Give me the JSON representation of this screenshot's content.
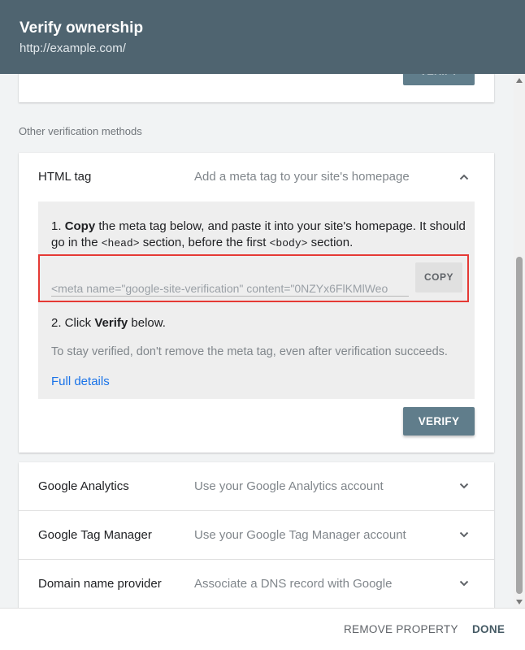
{
  "header": {
    "title": "Verify ownership",
    "url": "http://example.com/"
  },
  "top_card": {
    "verify_label": "VERIFY"
  },
  "section_label": "Other verification methods",
  "html_tag": {
    "title": "HTML tag",
    "description": "Add a meta tag to your site's homepage",
    "step1": {
      "prefix": "1. ",
      "bold": "Copy",
      "text_a": " the meta tag below, and paste it into your site's homepage. It should go in the ",
      "code_head": "<head>",
      "text_b": " section, before the first ",
      "code_body": "<body>",
      "text_c": " section."
    },
    "meta_value": "<meta name=\"google-site-verification\" content=\"0NZYx6FlKMlWeo",
    "copy_label": "COPY",
    "step2": {
      "prefix": "2. Click ",
      "bold": "Verify",
      "suffix": " below."
    },
    "stay_verified": "To stay verified, don't remove the meta tag, even after verification succeeds.",
    "full_details": "Full details",
    "verify_label": "VERIFY"
  },
  "methods": [
    {
      "title": "Google Analytics",
      "description": "Use your Google Analytics account"
    },
    {
      "title": "Google Tag Manager",
      "description": "Use your Google Tag Manager account"
    },
    {
      "title": "Domain name provider",
      "description": "Associate a DNS record with Google"
    }
  ],
  "footer": {
    "remove_label": "REMOVE PROPERTY",
    "done_label": "DONE"
  },
  "colors": {
    "header_bg": "#4f6470",
    "button_bg": "#607d8b",
    "link": "#1a73e8",
    "highlight": "#e53935"
  },
  "icons": {
    "expanded": "chevron-up-icon",
    "collapsed": "chevron-down-icon"
  }
}
